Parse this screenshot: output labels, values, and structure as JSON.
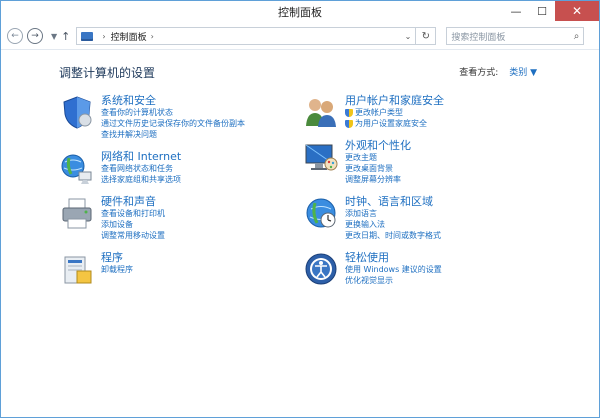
{
  "window": {
    "title": "控制面板",
    "minimize": "—",
    "maximize": "☐",
    "close": "✕"
  },
  "navbar": {
    "back": "←",
    "forward": "→",
    "recent": "▼",
    "up": "↑",
    "address": {
      "crumb": "控制面板",
      "sep": "›",
      "dropdown": "⌄"
    },
    "refresh": "↻",
    "search": {
      "placeholder": "搜索控制面板",
      "icon": "⌕"
    }
  },
  "content": {
    "heading": "调整计算机的设置",
    "view_by": {
      "label": "查看方式:",
      "value": "类别 ▼"
    },
    "groups": [
      {
        "key": "system-security",
        "icon": "shield-icon",
        "title": "系统和安全",
        "links": [
          "查看你的计算机状态",
          "通过文件历史记录保存你的文件备份副本",
          "查找并解决问题"
        ]
      },
      {
        "key": "network-internet",
        "icon": "globe-network-icon",
        "title": "网络和 Internet",
        "links": [
          "查看网络状态和任务",
          "选择家庭组和共享选项"
        ]
      },
      {
        "key": "hardware-sound",
        "icon": "printer-icon",
        "title": "硬件和声音",
        "links": [
          "查看设备和打印机",
          "添加设备",
          "调整常用移动设置"
        ]
      },
      {
        "key": "programs",
        "icon": "programs-icon",
        "title": "程序",
        "links": [
          "卸载程序"
        ]
      },
      {
        "key": "user-accounts",
        "icon": "users-icon",
        "title": "用户帐户和家庭安全",
        "links": [
          "更改帐户类型",
          "为用户设置家庭安全"
        ],
        "shield_links": true
      },
      {
        "key": "appearance",
        "icon": "monitor-palette-icon",
        "title": "外观和个性化",
        "links": [
          "更改主题",
          "更改桌面背景",
          "调整屏幕分辨率"
        ]
      },
      {
        "key": "clock-language",
        "icon": "clock-globe-icon",
        "title": "时钟、语言和区域",
        "links": [
          "添加语言",
          "更换输入法",
          "更改日期、时间或数字格式"
        ]
      },
      {
        "key": "ease-access",
        "icon": "ease-of-access-icon",
        "title": "轻松使用",
        "links": [
          "使用 Windows 建议的设置",
          "优化视觉显示"
        ]
      }
    ]
  }
}
